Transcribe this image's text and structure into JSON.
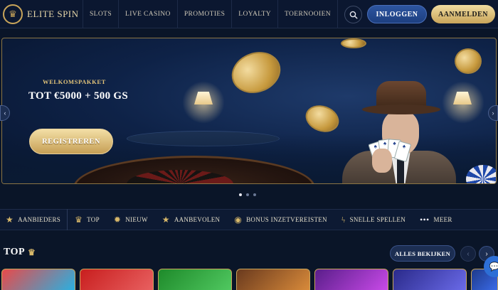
{
  "header": {
    "logo_text": "ELITE SPIN",
    "nav": [
      "SLOTS",
      "LIVE CASINO",
      "PROMOTIES",
      "LOYALTY",
      "TOERNOOIEN"
    ],
    "login_label": "INLOGGEN",
    "signup_label": "AANMELDEN"
  },
  "hero": {
    "subtitle": "Welkomspakket",
    "title": "Tot €5000 + 500 GS",
    "cta_label": "REGISTREREN",
    "slide_count": 3,
    "active_slide": 1
  },
  "categories": [
    {
      "icon": "star-icon",
      "label": "AANBIEDERS"
    },
    {
      "icon": "crown-icon",
      "label": "TOP"
    },
    {
      "icon": "new-badge-icon",
      "label": "NIEUW"
    },
    {
      "icon": "star-icon",
      "label": "AANBEVOLEN"
    },
    {
      "icon": "coin-icon",
      "label": "BONUS INZETVEREISTEN"
    },
    {
      "icon": "lightning-icon",
      "label": "SNELLE SPELLEN"
    },
    {
      "icon": "more-dots-icon",
      "label": "MEER"
    }
  ],
  "top_section": {
    "title": "TOP",
    "view_all_label": "ALLES BEKIJKEN"
  },
  "colors": {
    "background": "#0a1528",
    "gold_accent": "#c9a55a",
    "primary_blue": "#2d55a0"
  }
}
